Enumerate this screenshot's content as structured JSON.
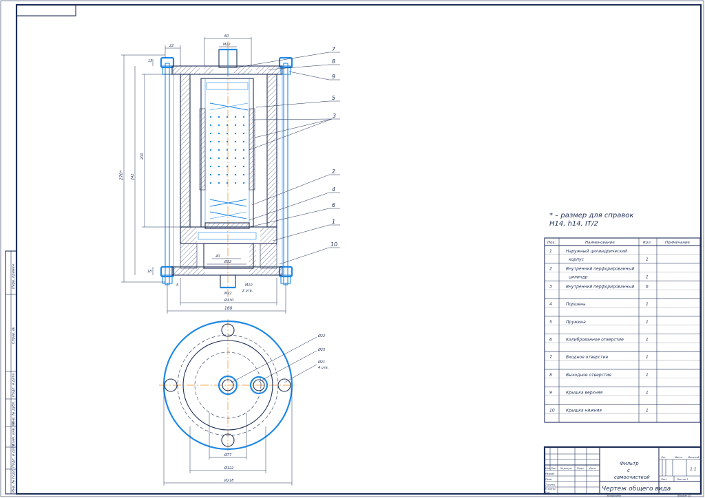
{
  "dims": {
    "top_width": "60",
    "top_inner": "M22",
    "left_small": "22",
    "left_offset": "15",
    "height_total": "270*",
    "height_inner": "242",
    "height_body": "200",
    "bottom_gap": "18",
    "bottom_offset": "5",
    "inner_d1": "40",
    "inner_d2": "Ø52",
    "thread": "M22",
    "bolt_note": "M10",
    "bolt_count": "2 отв.",
    "d_inner": "Ø130",
    "d_outer": "160",
    "plan_d1": "Ø22",
    "plan_d2": "Ø25",
    "plan_hole": "Ø21",
    "plan_hole_count": "4 отв.",
    "plan_w1": "Ø77",
    "plan_w2": "Ø122",
    "plan_w3": "Ø218"
  },
  "callouts": [
    "7",
    "8",
    "9",
    "5",
    "3",
    "2",
    "4",
    "6",
    "1",
    "10"
  ],
  "notes": {
    "line1": "* – размер для справок",
    "line2": "H14, h14, IT/2"
  },
  "spec": {
    "headers": [
      "Поз.",
      "Наименование",
      "Кол.",
      "Примечание"
    ],
    "rows": [
      {
        "pos": "1",
        "name_a": "Наружный цилиндрический",
        "name_b": "корпус",
        "qty": "1"
      },
      {
        "pos": "2",
        "name_a": "Внутренний перфорированный",
        "name_b": "цилиндр",
        "qty": "1"
      },
      {
        "pos": "3",
        "name_a": "Внутренний перфорированный",
        "name_b": "",
        "qty": "6"
      },
      {
        "pos": "4",
        "name_a": "Поршень",
        "name_b": "",
        "qty": "1"
      },
      {
        "pos": "5",
        "name_a": "Пружина",
        "name_b": "",
        "qty": "1"
      },
      {
        "pos": "6",
        "name_a": "Калиброванное отверстие",
        "name_b": "",
        "qty": "1"
      },
      {
        "pos": "7",
        "name_a": "Входное отверстие",
        "name_b": "",
        "qty": "1"
      },
      {
        "pos": "8",
        "name_a": "Выходное отверстие",
        "name_b": "",
        "qty": "1"
      },
      {
        "pos": "9",
        "name_a": "Крышка верхняя",
        "name_b": "",
        "qty": "1"
      },
      {
        "pos": "10",
        "name_a": "Крышка нижняя",
        "name_b": "",
        "qty": "1"
      }
    ]
  },
  "titleblock": {
    "name_l1": "Фильтр",
    "name_l2": "с",
    "name_l3": "самоочисткой",
    "doc_title": "Чертеж общего вида",
    "scale": "1:1",
    "col_lit": "Лит.",
    "col_mass": "Масса",
    "col_scale": "Масштаб",
    "sheet": "Лист",
    "sheets": "Листов 1",
    "izm": "Изм.",
    "list": "Лист",
    "ndoc": "№ докум.",
    "podp": "Подп.",
    "data": "Дата",
    "razrab": "Разраб.",
    "prov": "Пров.",
    "tkontr": "Т.контр.",
    "nkontr": "Н.контр.",
    "utv": "Утв.",
    "copied": "Копировал",
    "format": "Формат A1"
  },
  "side_strip": {
    "perv": "Перв. примен.",
    "sprav": "Справ. №",
    "podp_data1": "Подп. и дата",
    "inv_dubl": "Инв. № дубл.",
    "vzam": "Взам. инв. №",
    "podp_data2": "Подп. и дата",
    "inv_podl": "Инв. № подл."
  }
}
